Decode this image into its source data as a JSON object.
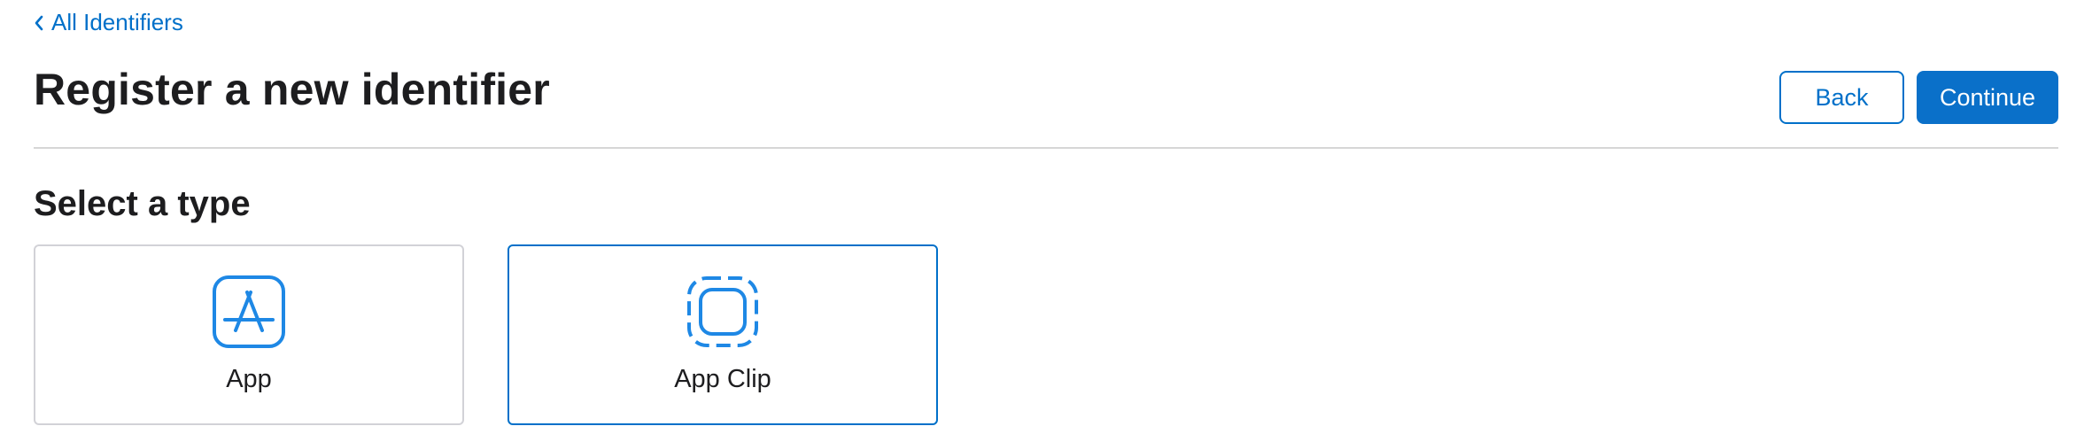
{
  "breadcrumb": {
    "label": "All Identifiers",
    "icon": "chevron-left-icon"
  },
  "header": {
    "title": "Register a new identifier",
    "back_label": "Back",
    "continue_label": "Continue"
  },
  "section": {
    "title": "Select a type"
  },
  "types": [
    {
      "label": "App",
      "icon": "app-store-icon",
      "selected": false
    },
    {
      "label": "App Clip",
      "icon": "app-clip-icon",
      "selected": true
    }
  ],
  "colors": {
    "accent": "#0070c9",
    "text": "#1d1d1f",
    "icon": "#1e88e5",
    "divider": "#d6d6d6",
    "card_border": "#d2d2d7"
  }
}
